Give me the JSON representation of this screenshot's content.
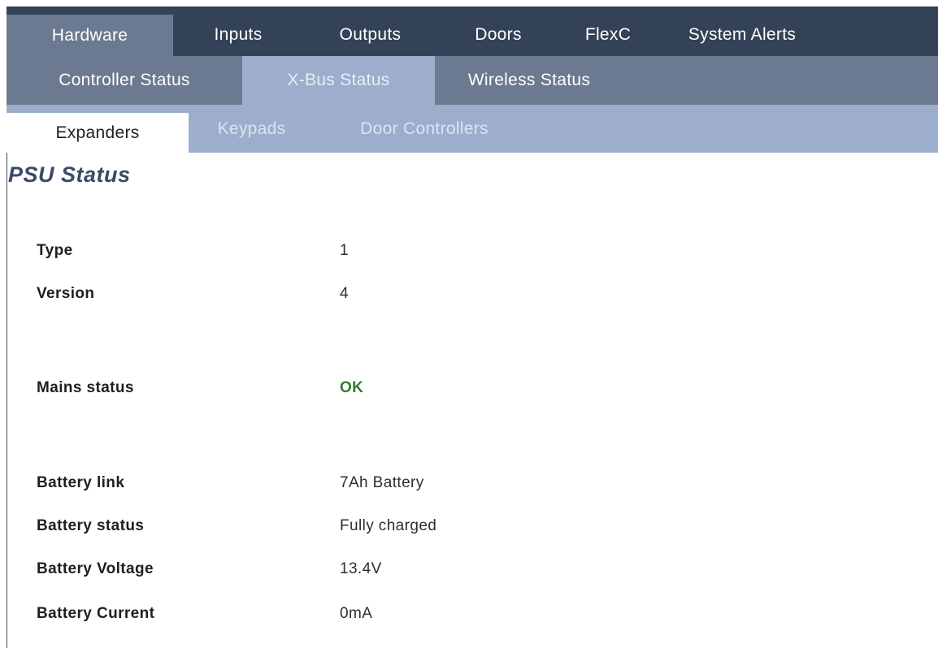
{
  "nav": {
    "primary_tabs": [
      {
        "label": "Hardware"
      },
      {
        "label": "Inputs"
      },
      {
        "label": "Outputs"
      },
      {
        "label": "Doors"
      },
      {
        "label": "FlexC"
      },
      {
        "label": "System Alerts"
      }
    ],
    "primary_active": "Hardware",
    "secondary_tabs": [
      {
        "label": "Controller Status"
      },
      {
        "label": "X-Bus Status"
      },
      {
        "label": "Wireless Status"
      }
    ],
    "secondary_active": "X-Bus Status",
    "tertiary_tabs": [
      {
        "label": "Expanders"
      },
      {
        "label": "Keypads"
      },
      {
        "label": "Door Controllers"
      }
    ],
    "tertiary_active": "Expanders"
  },
  "page": {
    "title": "PSU Status"
  },
  "psu": {
    "type": {
      "label": "Type",
      "value": "1"
    },
    "version": {
      "label": "Version",
      "value": "4"
    },
    "mains_status": {
      "label": "Mains status",
      "value": "OK"
    },
    "battery_link": {
      "label": "Battery link",
      "value": "7Ah Battery"
    },
    "battery_status": {
      "label": "Battery status",
      "value": "Fully charged"
    },
    "battery_voltage": {
      "label": "Battery Voltage",
      "value": "13.4V"
    },
    "battery_current": {
      "label": "Battery Current",
      "value": "0mA"
    }
  },
  "colors": {
    "primary_bar": "#334257",
    "secondary_bar": "#6b7a90",
    "tertiary_bar": "#9caecb",
    "title": "#3b4a66",
    "ok_status": "#2e7d2e"
  }
}
